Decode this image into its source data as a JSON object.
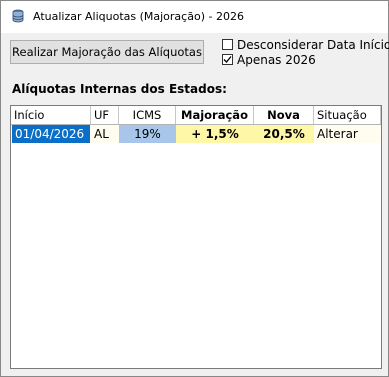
{
  "window": {
    "title": "Atualizar Aliquotas (Majoração) - 2026"
  },
  "toolbar": {
    "apply_button": "Realizar Majoração das Alíquotas"
  },
  "options": {
    "ignore_start_date": {
      "label": "Desconsiderar Data Início",
      "checked": false
    },
    "only_2026": {
      "label": "Apenas 2026",
      "checked": true
    }
  },
  "section_title": "Alíquotas Internas dos Estados:",
  "grid": {
    "columns": [
      "Início",
      "UF",
      "ICMS",
      "Majoração",
      "Nova",
      "Situação"
    ],
    "rows": [
      {
        "inicio": "01/04/2026",
        "uf": "AL",
        "icms": "19%",
        "majoracao": "+ 1,5%",
        "nova": "20,5%",
        "situacao": "Alterar"
      }
    ]
  },
  "colors": {
    "selected_cell": "#0b6ec7",
    "icms_cell": "#a7c6ea",
    "highlight_cell": "#fff7a8"
  }
}
